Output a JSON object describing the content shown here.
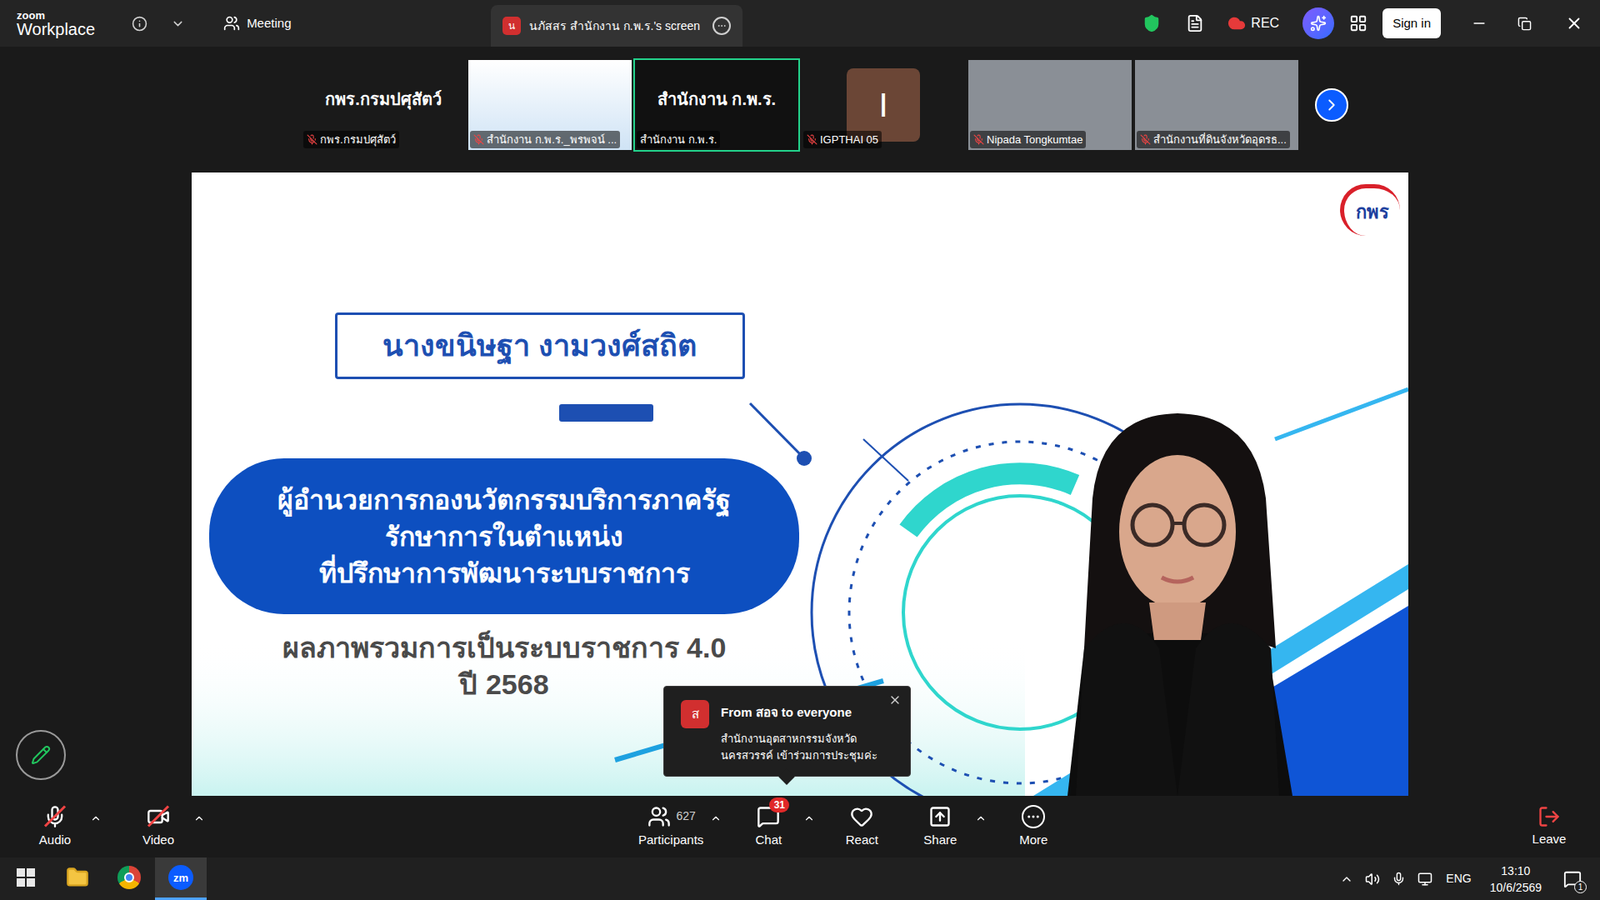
{
  "window": {
    "app_top": "zoom",
    "app_bottom": "Workplace",
    "meeting": "Meeting",
    "share_tab": {
      "avatar": "น",
      "label": "นภัสสร สำนักงาน ก.พ.ร.'s screen"
    },
    "rec": "REC",
    "sign_in": "Sign in"
  },
  "gallery": {
    "tiles": [
      {
        "kind": "name",
        "display_name": "กพร.กรมปศุสัตว์",
        "label": "กพร.กรมปศุสัตว์",
        "muted": true,
        "selected": false
      },
      {
        "kind": "slide",
        "label": "สำนักงาน ก.พ.ร._พรพจน์ ...",
        "muted": true,
        "selected": false
      },
      {
        "kind": "name",
        "display_name": "สำนักงาน ก.พ.ร.",
        "label": "สำนักงาน ก.พ.ร.",
        "muted": false,
        "selected": true
      },
      {
        "kind": "avatar",
        "avatar": "I",
        "label": "IGPTHAI 05",
        "muted": true,
        "selected": false
      },
      {
        "kind": "video",
        "label": "Nipada Tongkumtae",
        "muted": true,
        "selected": false
      },
      {
        "kind": "video",
        "label": "สำนักงานที่ดินจังหวัดอุดรธ...",
        "muted": true,
        "selected": false
      }
    ]
  },
  "slide": {
    "logo": "กพร",
    "name": "นางขนิษฐา งามวงศ์สถิต",
    "position_lines": [
      "ผู้อำนวยการกองนวัตกรรมบริการภาครัฐ",
      "รักษาการในตำแหน่ง",
      "ที่ปรึกษาการพัฒนาระบบราชการ"
    ],
    "summary": "ผลภาพรวมการเป็นระบบราชการ 4.0",
    "year": "ปี 2568"
  },
  "chat_toast": {
    "avatar": "ส",
    "header": "From สอจ to everyone",
    "lines": [
      "สำนักงานอุตสาหกรรมจังหวัด",
      "นครสวรรค์ เข้าร่วมการประชุมค่ะ"
    ]
  },
  "toolbar": {
    "items": [
      {
        "kind": "audio",
        "label": "Audio",
        "off": true,
        "caret": true
      },
      {
        "kind": "video",
        "label": "Video",
        "off": true,
        "caret": true
      },
      {
        "kind": "participants",
        "label": "Participants",
        "count": "627",
        "off": false,
        "caret": true
      },
      {
        "kind": "chat",
        "label": "Chat",
        "badge": "31",
        "off": false,
        "caret": true
      },
      {
        "kind": "react",
        "label": "React",
        "off": false,
        "caret": false
      },
      {
        "kind": "share",
        "label": "Share",
        "off": false,
        "caret": true
      },
      {
        "kind": "more",
        "label": "More",
        "off": false,
        "caret": false
      }
    ],
    "leave": "Leave"
  },
  "taskbar": {
    "apps": [
      {
        "kind": "start",
        "selected": false
      },
      {
        "kind": "explorer",
        "selected": false
      },
      {
        "kind": "chrome",
        "selected": false
      },
      {
        "kind": "zoom",
        "text": "zm",
        "selected": true
      }
    ],
    "language": "ENG",
    "time": "13:10",
    "date": "10/6/2569",
    "notifications": "1"
  }
}
